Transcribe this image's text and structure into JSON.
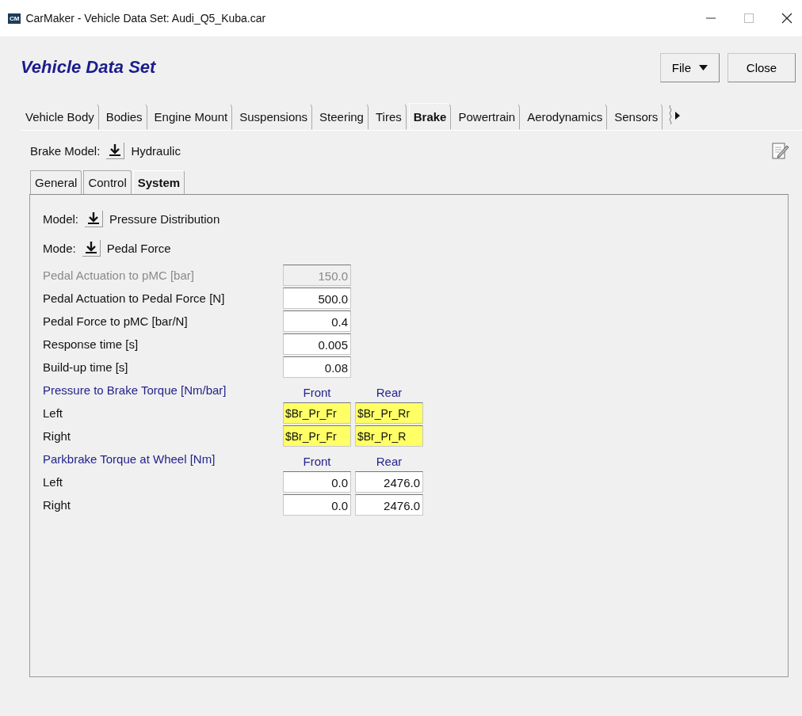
{
  "window": {
    "logo": "CM",
    "title": "CarMaker - Vehicle Data Set: Audi_Q5_Kuba.car"
  },
  "header": {
    "title": "Vehicle Data Set",
    "buttons": [
      {
        "label": "File",
        "kind": "menu"
      },
      {
        "label": "Close",
        "kind": "plain"
      }
    ]
  },
  "tabs": [
    {
      "label": "Vehicle Body",
      "selected": false
    },
    {
      "label": "Bodies",
      "selected": false
    },
    {
      "label": "Engine Mount",
      "selected": false
    },
    {
      "label": "Suspensions",
      "selected": false
    },
    {
      "label": "Steering",
      "selected": false
    },
    {
      "label": "Tires",
      "selected": false
    },
    {
      "label": "Brake",
      "selected": true
    },
    {
      "label": "Powertrain",
      "selected": false
    },
    {
      "label": "Aerodynamics",
      "selected": false
    },
    {
      "label": "Sensors",
      "selected": false
    }
  ],
  "brake_model": {
    "label": "Brake Model:",
    "value": "Hydraulic"
  },
  "subtabs": [
    {
      "label": "General",
      "selected": false
    },
    {
      "label": "Control",
      "selected": false
    },
    {
      "label": "System",
      "selected": true
    }
  ],
  "system": {
    "selectors": [
      {
        "label": "Model:",
        "value": "Pressure Distribution"
      },
      {
        "label": "Mode:",
        "value": "Pedal Force"
      }
    ],
    "params": [
      {
        "label": "Pedal Actuation to pMC [bar]",
        "value": "150.0",
        "disabled": true
      },
      {
        "label": "Pedal Actuation to Pedal Force [N]",
        "value": "500.0",
        "disabled": false
      },
      {
        "label": "Pedal Force to pMC [bar/N]",
        "value": "0.4",
        "disabled": false
      },
      {
        "label": "Response time [s]",
        "value": "0.005",
        "disabled": false
      },
      {
        "label": "Build-up time [s]",
        "value": "0.08",
        "disabled": false
      }
    ],
    "sections": [
      {
        "title": "Pressure to Brake Torque [Nm/bar]",
        "columns": [
          "Front",
          "Rear"
        ],
        "rows": [
          {
            "label": "Left",
            "values": [
              {
                "text": "$Br_Pr_Fr",
                "highlighted": true
              },
              {
                "text": "$Br_Pr_Rr",
                "highlighted": true
              }
            ]
          },
          {
            "label": "Right",
            "values": [
              {
                "text": "$Br_Pr_Fr",
                "highlighted": true
              },
              {
                "text": "$Br_Pr_R",
                "highlighted": true
              }
            ]
          }
        ]
      },
      {
        "title": "Parkbrake Torque at Wheel [Nm]",
        "columns": [
          "Front",
          "Rear"
        ],
        "rows": [
          {
            "label": "Left",
            "values": [
              {
                "text": "0.0",
                "highlighted": false
              },
              {
                "text": "2476.0",
                "highlighted": false
              }
            ]
          },
          {
            "label": "Right",
            "values": [
              {
                "text": "0.0",
                "highlighted": false
              },
              {
                "text": "2476.0",
                "highlighted": false
              }
            ]
          }
        ]
      }
    ]
  }
}
